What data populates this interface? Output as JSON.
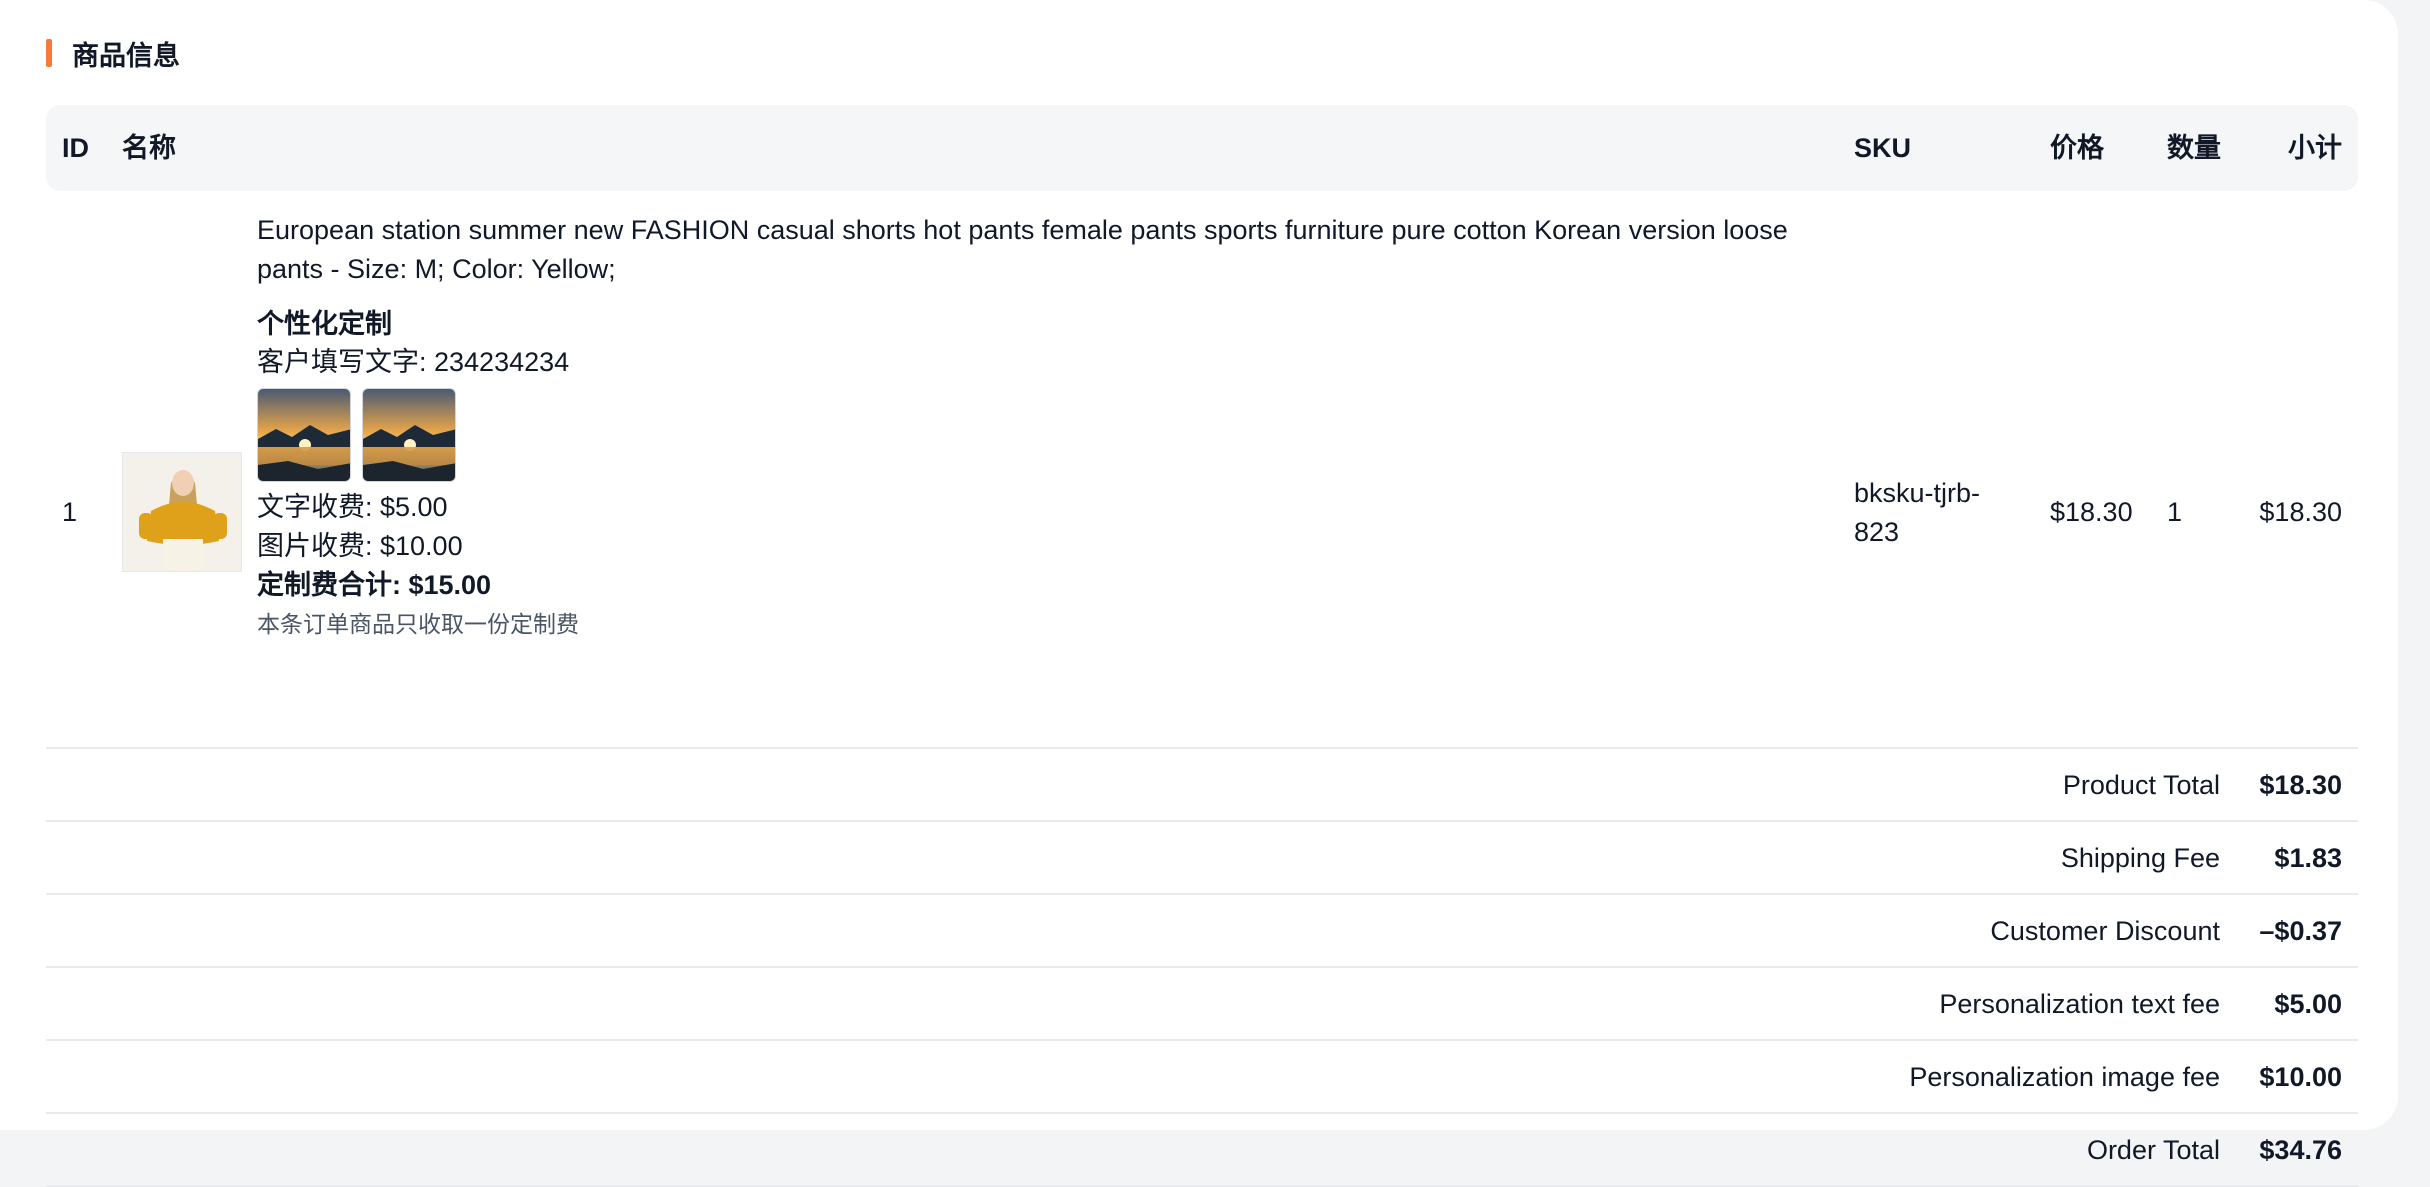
{
  "section": {
    "title": "商品信息"
  },
  "table": {
    "headers": {
      "id": "ID",
      "name": "名称",
      "sku": "SKU",
      "price": "价格",
      "qty": "数量",
      "subtotal": "小计"
    }
  },
  "item": {
    "id": "1",
    "name": "European station summer new FASHION casual shorts hot pants female pants sports furniture pure cotton Korean version loose pants - Size: M; Color: Yellow;",
    "customization": {
      "title": "个性化定制",
      "text_line": "客户填写文字: 234234234",
      "text_fee": "文字收费: $5.00",
      "image_fee": "图片收费: $10.00",
      "fee_total": "定制费合计: $15.00",
      "note": "本条订单商品只收取一份定制费"
    },
    "sku": "bksku-tjrb-823",
    "price": "$18.30",
    "qty": "1",
    "subtotal": "$18.30"
  },
  "summary": [
    {
      "label": "Product Total",
      "value": "$18.30"
    },
    {
      "label": "Shipping Fee",
      "value": "$1.83"
    },
    {
      "label": "Customer Discount",
      "value": "–$0.37"
    },
    {
      "label": "Personalization text fee",
      "value": "$5.00"
    },
    {
      "label": "Personalization image fee",
      "value": "$10.00"
    },
    {
      "label": "Order Total",
      "value": "$34.76"
    }
  ],
  "colors": {
    "accent": "#f47b3a",
    "header_bg": "#f5f6f8",
    "divider": "#e8eaee"
  }
}
